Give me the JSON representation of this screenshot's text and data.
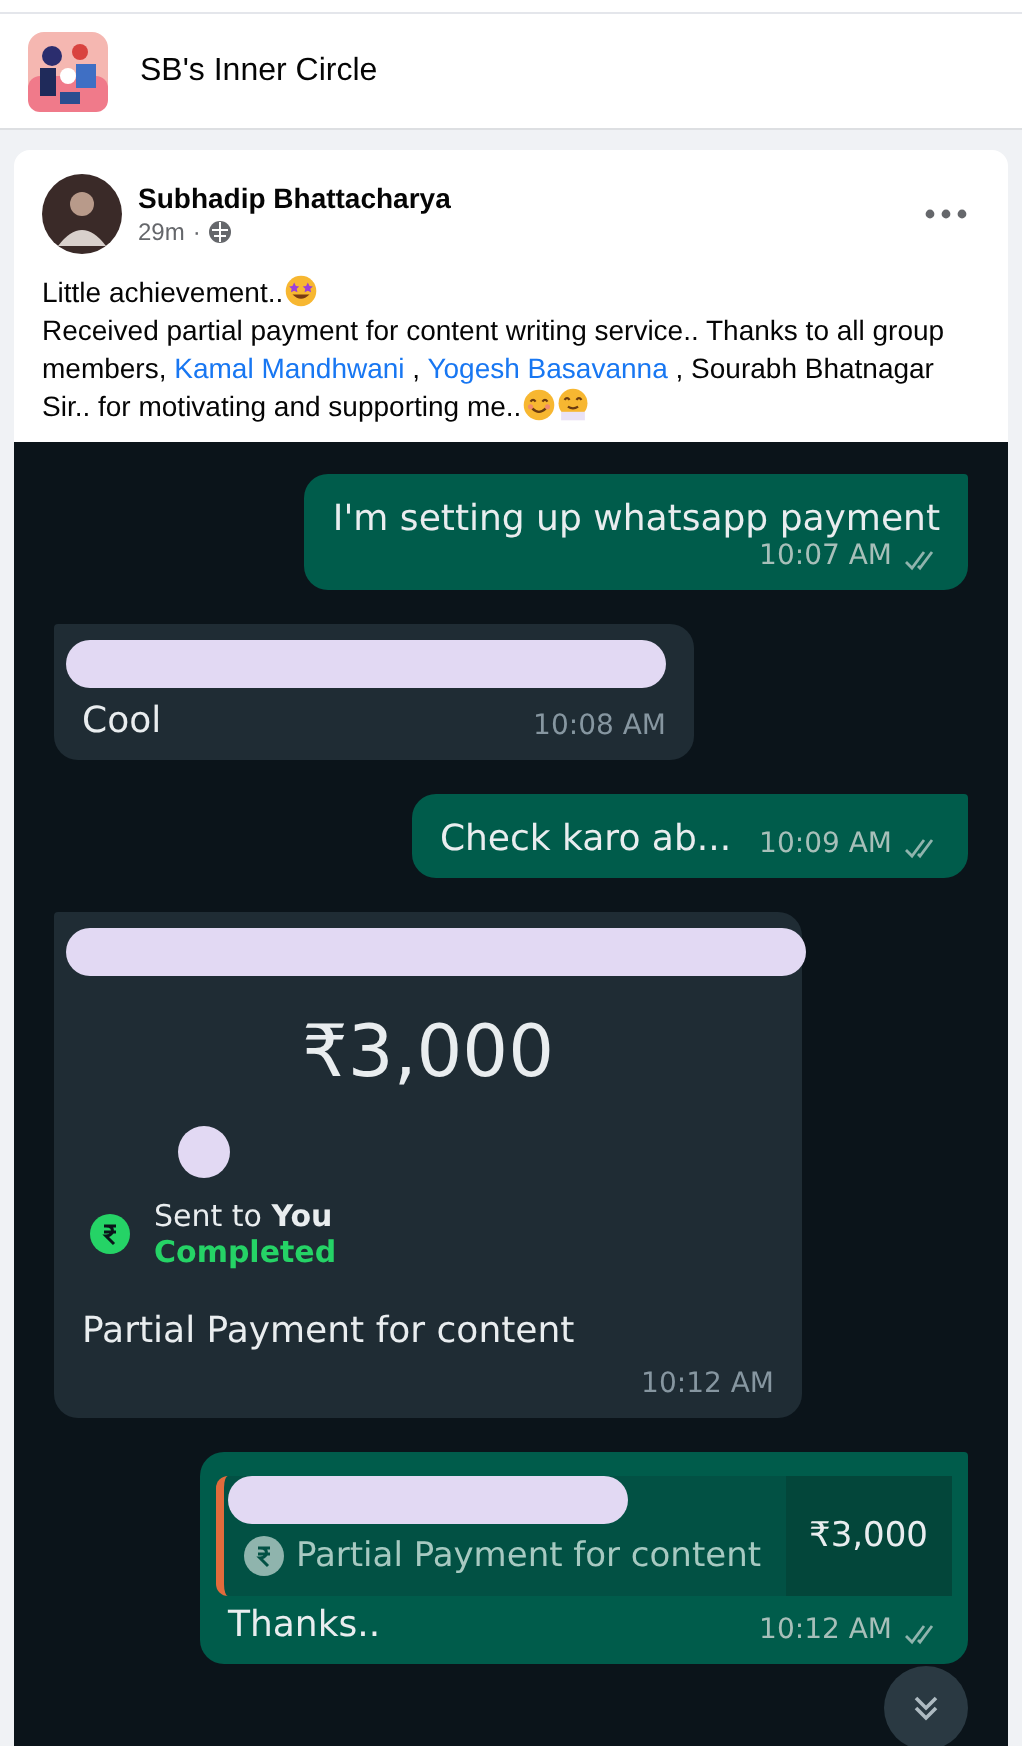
{
  "group": {
    "name": "SB's Inner Circle"
  },
  "post": {
    "author": "Subhadip Bhattacharya",
    "time": "29m",
    "separator": "·",
    "body": [
      {
        "kind": "text",
        "text": "Little achievement.."
      },
      {
        "kind": "emoji_star"
      },
      {
        "kind": "break"
      },
      {
        "kind": "text",
        "text": "Received partial payment for content writing service.. Thanks to all group members, "
      },
      {
        "kind": "link",
        "text": "Kamal Mandhwani"
      },
      {
        "kind": "text",
        "text": " , "
      },
      {
        "kind": "link",
        "text": "Yogesh Basavanna"
      },
      {
        "kind": "text",
        "text": " , Sourabh Bhatnagar Sir.. for motivating and supporting me.."
      },
      {
        "kind": "emoji_smile"
      },
      {
        "kind": "emoji_hug"
      }
    ]
  },
  "chat": {
    "messages": [
      {
        "kind": "outgoing",
        "text": "I'm setting up whatsapp payment",
        "time": "10:07 AM",
        "redacted": false
      },
      {
        "kind": "incoming",
        "text": "Cool",
        "time": "10:08 AM",
        "redacted": true
      },
      {
        "kind": "outgoing",
        "text": "Check karo ab...",
        "time": "10:09 AM",
        "redacted": false
      },
      {
        "kind": "payment",
        "amount": "₹3,000",
        "recipient": "Sent to **You**",
        "status": "Completed",
        "note": "Partial Payment for content",
        "time": "10:12 AM",
        "redacted": true
      },
      {
        "kind": "reply",
        "quote": "Partial Payment for content",
        "quote_amount": "₹3,000",
        "text": "Thanks..",
        "time": "10:12 AM",
        "redacted": true
      }
    ]
  }
}
